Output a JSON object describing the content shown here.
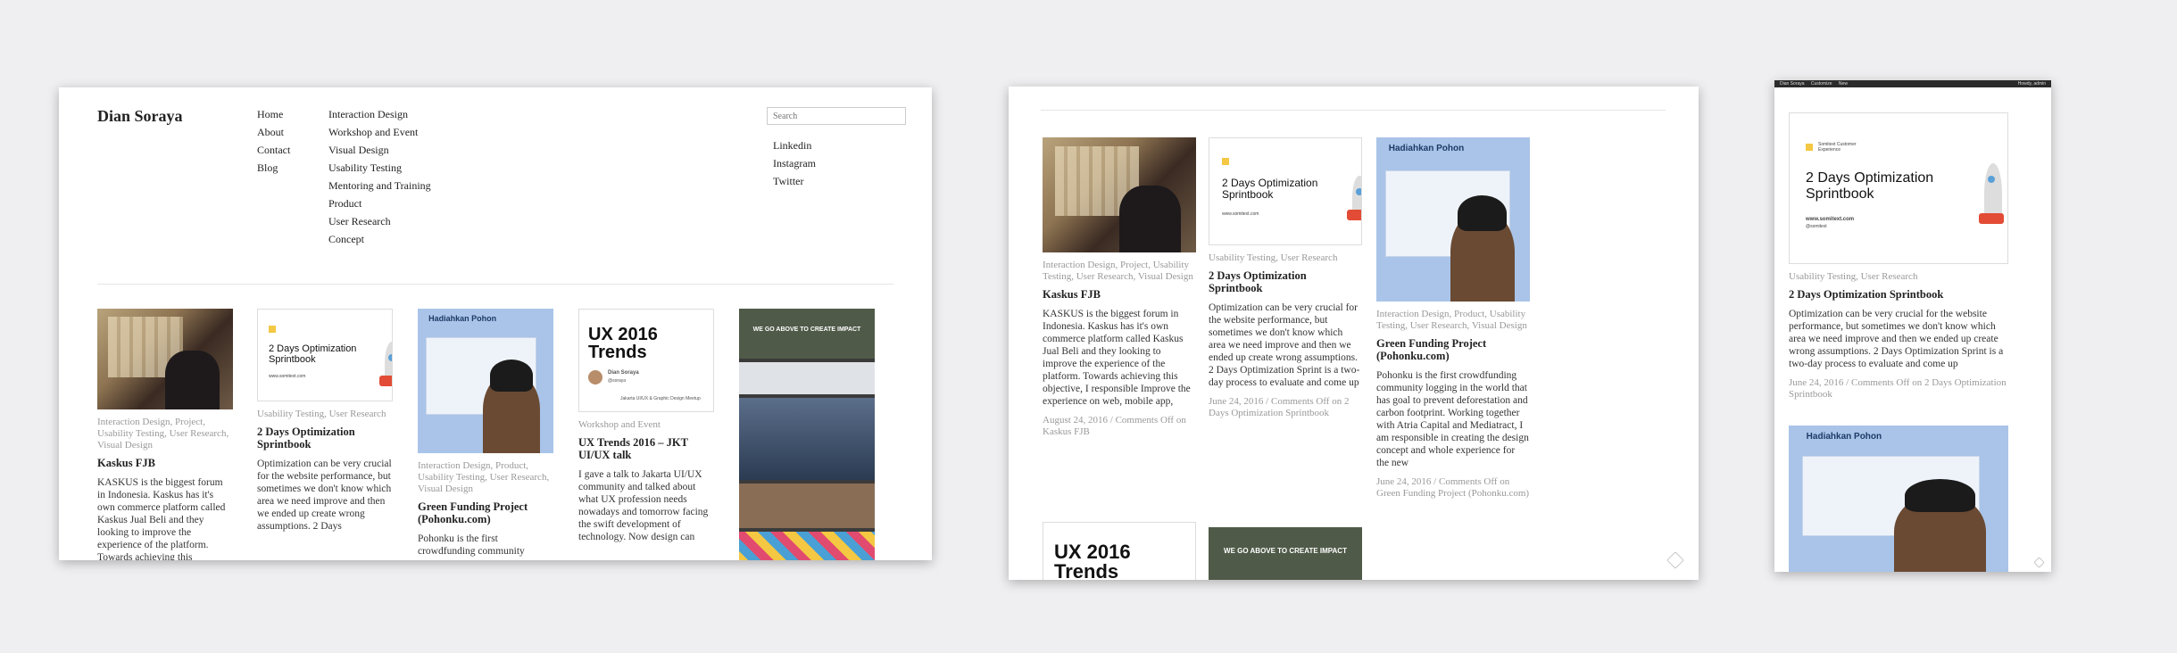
{
  "desktop": {
    "site_title": "Dian Soraya",
    "nav_primary": [
      "Home",
      "About",
      "Contact",
      "Blog"
    ],
    "nav_categories": [
      "Interaction Design",
      "Workshop and Event",
      "Visual Design",
      "Usability Testing",
      "Mentoring and Training",
      "Product",
      "User Research",
      "Concept"
    ],
    "search_placeholder": "Search",
    "social": [
      "Linkedin",
      "Instagram",
      "Twitter"
    ],
    "posts": [
      {
        "categories": "Interaction Design, Project, Usability Testing, User Research, Visual Design",
        "title": "Kaskus FJB",
        "excerpt": "KASKUS is the biggest forum in Indonesia. Kaskus has it's own commerce platform called Kaskus Jual Beli and they looking to improve the experience of the platform. Towards achieving this"
      },
      {
        "categories": "Usability Testing, User Research",
        "title": "2 Days Optimization Sprintbook",
        "excerpt": "Optimization can be very crucial for the website performance, but sometimes we don't know which area we need improve and then we ended up create wrong assumptions. 2 Days"
      },
      {
        "categories": "Interaction Design, Product, Usability Testing, User Research, Visual Design",
        "title": "Green Funding Project (Pohonku.com)",
        "excerpt": "Pohonku is the first crowdfunding community"
      },
      {
        "categories": "Workshop and Event",
        "title": "UX Trends 2016 – JKT UI/UX talk",
        "excerpt": "I gave a talk to Jakarta UI/UX community and talked about what UX profession needs nowadays and tomorrow facing the swift development of technology. Now design can"
      }
    ]
  },
  "tablet": {
    "posts": [
      {
        "categories": "Interaction Design, Project, Usability Testing, User Research, Visual Design",
        "title": "Kaskus FJB",
        "excerpt": "KASKUS is the biggest forum in Indonesia. Kaskus has it's own commerce platform called Kaskus Jual Beli and they looking to improve the experience of the platform. Towards achieving this objective, I responsible Improve the experience on web, mobile app,",
        "date": "August 24, 2016",
        "comments": "Comments Off on Kaskus FJB"
      },
      {
        "categories": "Usability Testing, User Research",
        "title": "2 Days Optimization Sprintbook",
        "excerpt": "Optimization can be very crucial for the website performance, but sometimes we don't know which area we need improve and then we ended up create wrong assumptions. 2 Days Optimization Sprint is a two-day process to evaluate and come up",
        "date": "June 24, 2016",
        "comments": "Comments Off on 2 Days Optimization Sprintbook"
      },
      {
        "categories": "Interaction Design, Product, Usability Testing, User Research, Visual Design",
        "title": "Green Funding Project (Pohonku.com)",
        "excerpt": "Pohonku is the first crowdfunding community logging in the world that has goal to prevent deforestation and carbon footprint. Working together with Atria Capital and Mediatract, I am responsible in creating the design concept and whole experience for the new",
        "date": "June 24, 2016",
        "comments": "Comments Off on Green Funding Project (Pohonku.com)"
      }
    ]
  },
  "mobile": {
    "statusbar_left": [
      "Dian Soraya",
      "Customize",
      "New"
    ],
    "statusbar_right": "Howdy, admin",
    "post": {
      "categories": "Usability Testing, User Research",
      "title": "2 Days Optimization Sprintbook",
      "excerpt": "Optimization can be very crucial for the website performance, but sometimes we don't know which area we need improve and then we ended up create wrong assumptions. 2 Days Optimization Sprint is a two-day process to evaluate and come up",
      "date": "June 24, 2016",
      "comments": "Comments Off on 2 Days Optimization Sprintbook"
    }
  },
  "thumbs": {
    "sprint_title": "2 Days Optimization Sprintbook",
    "sprint_url": "www.somitext.com",
    "sprint_by": "@somitext",
    "sprint_brand": "Somitext Customer Experience",
    "pohon_title": "Hadiahkan Pohon",
    "ux_title": "UX 2016 Trends",
    "ux_author": "Dian Soraya",
    "ux_handle": "@soraya",
    "ux_event": "Jakarta UI/UX & Graphic Design Meetup",
    "workshop_banner": "WE GO ABOVE TO CREATE IMPACT"
  },
  "colors": {
    "background": "#efeff1",
    "meta_text": "#999999",
    "title_text": "#222222",
    "sprint_accent": "#f4c842",
    "pohon_bg": "#a9c4e8"
  }
}
